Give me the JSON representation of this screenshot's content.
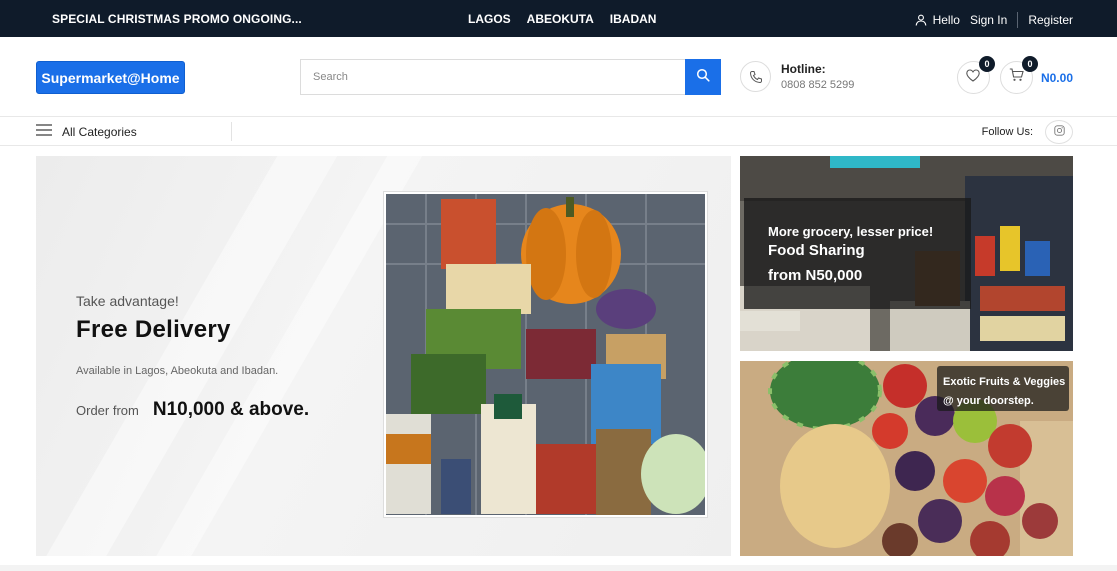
{
  "topbar": {
    "promo": "SPECIAL CHRISTMAS PROMO ONGOING...",
    "cities": [
      "LAGOS",
      "ABEOKUTA",
      "IBADAN"
    ],
    "hello": "Hello",
    "signin": "Sign In",
    "register": "Register"
  },
  "header": {
    "logo": "Supermarket@Home",
    "search_placeholder": "Search",
    "hotline_title": "Hotline:",
    "hotline_number": "0808 852 5299",
    "wishlist_count": "0",
    "cart_count": "0",
    "cart_total": "N0.00"
  },
  "nav": {
    "all_categories": "All Categories",
    "follow_us": "Follow Us:"
  },
  "hero": {
    "tag": "Take advantage!",
    "headline": "Free Delivery",
    "availability": "Available in Lagos, Abeokuta and Ibadan.",
    "order_label": "Order from",
    "order_amount": "N10,000 & above."
  },
  "side_banner_1": {
    "line1": "More grocery, lesser price!",
    "line2": "Food Sharing",
    "line3": "from N50,000"
  },
  "side_banner_2": {
    "line1": "Exotic Fruits & Veggies",
    "line2": "@ your doorstep."
  },
  "colors": {
    "brand_blue": "#1a6fe8",
    "topbar_dark": "#0f1b2a"
  },
  "icons": [
    "user-icon",
    "search-icon",
    "phone-icon",
    "heart-icon",
    "cart-icon",
    "menu-icon",
    "instagram-icon"
  ]
}
